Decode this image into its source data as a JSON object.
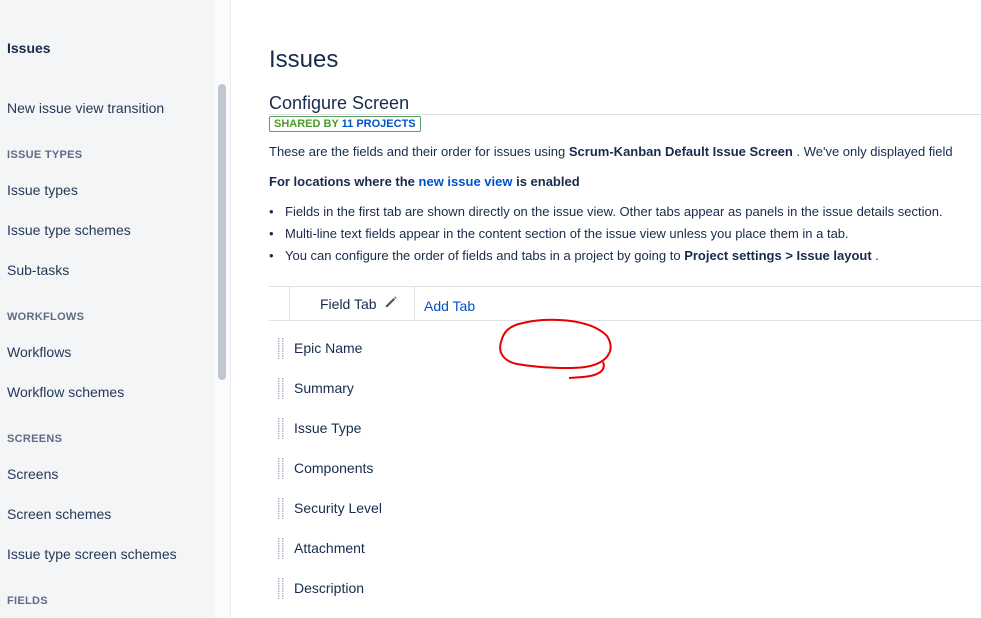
{
  "sidebar": {
    "title": "Issues",
    "items": [
      {
        "type": "item",
        "label": "New issue view transition"
      },
      {
        "type": "heading",
        "label": "ISSUE TYPES"
      },
      {
        "type": "item",
        "label": "Issue types"
      },
      {
        "type": "item",
        "label": "Issue type schemes"
      },
      {
        "type": "item",
        "label": "Sub-tasks"
      },
      {
        "type": "heading",
        "label": "WORKFLOWS"
      },
      {
        "type": "item",
        "label": "Workflows"
      },
      {
        "type": "item",
        "label": "Workflow schemes"
      },
      {
        "type": "heading",
        "label": "SCREENS"
      },
      {
        "type": "item",
        "label": "Screens"
      },
      {
        "type": "item",
        "label": "Screen schemes"
      },
      {
        "type": "item",
        "label": "Issue type screen schemes"
      },
      {
        "type": "heading",
        "label": "FIELDS"
      }
    ]
  },
  "main": {
    "page_title": "Issues",
    "config_title": "Configure Screen",
    "shared_badge": {
      "prefix": "SHARED BY",
      "link": "11 PROJECTS"
    },
    "description": {
      "prefix": "These are the fields and their order for issues using ",
      "screen": "Scrum-Kanban Default Issue Screen",
      "suffix": " . We've only displayed field"
    },
    "locations": {
      "prefix": "For locations where the ",
      "link": "new issue view",
      "suffix": " is enabled"
    },
    "bullets": [
      {
        "text": "Fields in the first tab are shown directly on the issue view. Other tabs appear as panels in the issue details section."
      },
      {
        "text": "Multi-line text fields appear in the content section of the issue view unless you place them in a tab."
      },
      {
        "text": "You can configure the order of fields and tabs in a project by going to ",
        "bold": "Project settings > Issue layout",
        "tail": " ."
      }
    ],
    "tabs": {
      "field_tab": "Field Tab",
      "add_tab": "Add Tab"
    },
    "fields": [
      "Epic Name",
      "Summary",
      "Issue Type",
      "Components",
      "Security Level",
      "Attachment",
      "Description"
    ]
  },
  "colors": {
    "accent": "#0052cc",
    "annotation": "#e60000",
    "badge_green": "#4c9a2a"
  },
  "icons": [
    "pencil-icon",
    "drag-handle-icon"
  ]
}
